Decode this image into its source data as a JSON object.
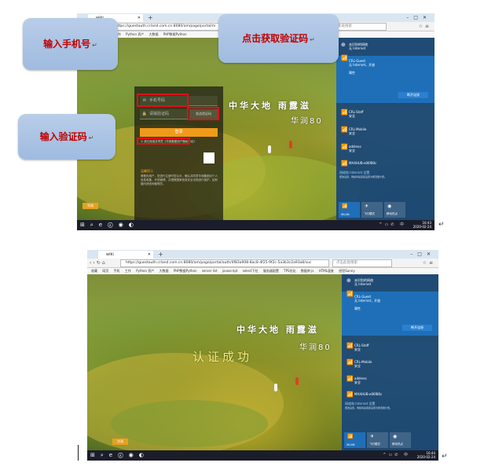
{
  "screenshot1": {
    "tab_title": "wiki",
    "url": "https://guestauth.crland.com.cn:8080/am/page/portal/m",
    "search_placeholder": "点击此处搜索",
    "bookmarks": [
      "收藏",
      "网页",
      "手机",
      "工作",
      "Python 资产",
      "大数据",
      "PHP数据Python"
    ],
    "headline": "中华大地  雨露滋",
    "subline": "华润80",
    "login": {
      "phone_placeholder": "手机号码",
      "code_placeholder": "请输验证码",
      "get_code_label": "发送验证码",
      "login_button": "登录",
      "agree_text": "我已阅读并同意《华润集团用户隐私协议》",
      "notice_title": "温馨提示",
      "notice_text": "尊敬的用户，您进行注册时您认可，确认并同意华润集团对个人信息收集，开放管理，并遵照国家信息安全法规进行保护，如有疑问请咨询管理员。"
    },
    "brand": "华润",
    "callouts": {
      "phone": "输入手机号",
      "get_code": "点击获取验证码",
      "code": "输入验证码"
    }
  },
  "screenshot2": {
    "tab_title": "wiki",
    "url": "https://guestauth.crland.com.cn:8080/am/page/portal/auth/4f83a908-8ac8-4f25-9f2c-5a3b3c2a93a8/suc",
    "search_placeholder": "点击此处搜索",
    "bookmarks": [
      "收藏",
      "网页",
      "手机",
      "工作",
      "Python 资产",
      "大数据",
      "PHP数据Python",
      "server list",
      "javascript",
      "select下拉",
      "服务器配置",
      "TPS优化",
      "数据库-js",
      "HTML速查",
      "经验Sunny"
    ],
    "headline": "中华大地  雨露滋",
    "subline": "华润80",
    "success_text": "认证成功",
    "brand": "华润"
  },
  "network_panel": {
    "top_item": {
      "name": "未识别的网络",
      "status": "无 Internet"
    },
    "selected": {
      "name": "CRL-Guest",
      "status": "无 Internet，开放",
      "props": "属性",
      "disconnect": "断开连接"
    },
    "others": [
      {
        "name": "CRL-Staff",
        "status": "安全"
      },
      {
        "name": "CRL-Mobile",
        "status": "安全"
      },
      {
        "name": "address",
        "status": "安全"
      },
      {
        "name": "MAXHUB-e06f80c",
        "status": ""
      }
    ],
    "settings_link": "网络和 Internet 设置",
    "settings_sub": "更改设置，例如将某连接设置为按流量计费。",
    "tiles": [
      "WLAN",
      "飞行模式",
      "移动热点"
    ]
  },
  "taskbar": {
    "shot1_time": "16:43",
    "shot1_date": "2020-02-24",
    "shot2_time": "16:44",
    "shot2_date": "2020-02-24"
  }
}
